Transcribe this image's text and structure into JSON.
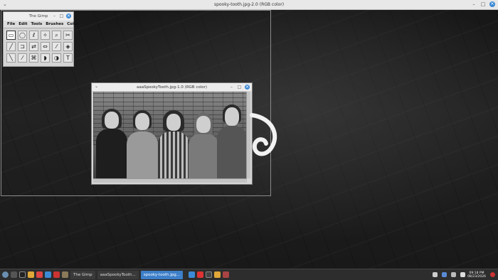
{
  "window": {
    "title": "spooky-tooth.jpg-2.0 (RGB color)"
  },
  "toolbox": {
    "title": "The Gimp",
    "menu": [
      "File",
      "Edit",
      "Tools",
      "Brushes",
      "Color"
    ],
    "tools": [
      {
        "icon": "rect-select-icon",
        "glyph": "▭"
      },
      {
        "icon": "ellipse-select-icon",
        "glyph": "◯"
      },
      {
        "icon": "free-select-icon",
        "glyph": "ℓ"
      },
      {
        "icon": "fuzzy-select-icon",
        "glyph": "✧"
      },
      {
        "icon": "zoom-icon",
        "glyph": "⌕"
      },
      {
        "icon": "scissors-icon",
        "glyph": "✂"
      },
      {
        "icon": "move-icon",
        "glyph": "╱"
      },
      {
        "icon": "crop-icon",
        "glyph": "⊐"
      },
      {
        "icon": "transform-icon",
        "glyph": "⇄"
      },
      {
        "icon": "flip-icon",
        "glyph": "⇔"
      },
      {
        "icon": "color-picker-icon",
        "glyph": "⁄"
      },
      {
        "icon": "bucket-fill-icon",
        "glyph": "◈"
      },
      {
        "icon": "brush-icon",
        "glyph": "╲"
      },
      {
        "icon": "airbrush-icon",
        "glyph": "⁄"
      },
      {
        "icon": "clone-icon",
        "glyph": "⌘"
      },
      {
        "icon": "smudge-icon",
        "glyph": "◗"
      },
      {
        "icon": "dodge-icon",
        "glyph": "◑"
      },
      {
        "icon": "text-icon",
        "glyph": "T"
      }
    ]
  },
  "image_window": {
    "title": "aaaSpookyTooth.jpg-1.0 (RGB color)"
  },
  "taskbar": {
    "tasks": [
      {
        "label": "The Gimp",
        "active": false
      },
      {
        "label": "aaaSpookyTooth...",
        "active": false
      },
      {
        "label": "spooky-tooth.jpg...",
        "active": true
      }
    ],
    "time": "09:18 PM",
    "date": "08/23/2026"
  },
  "colors": {
    "accent": "#3d7fc9",
    "taskbar": "#2d2d2d",
    "desktop": "#1c1c1c"
  }
}
